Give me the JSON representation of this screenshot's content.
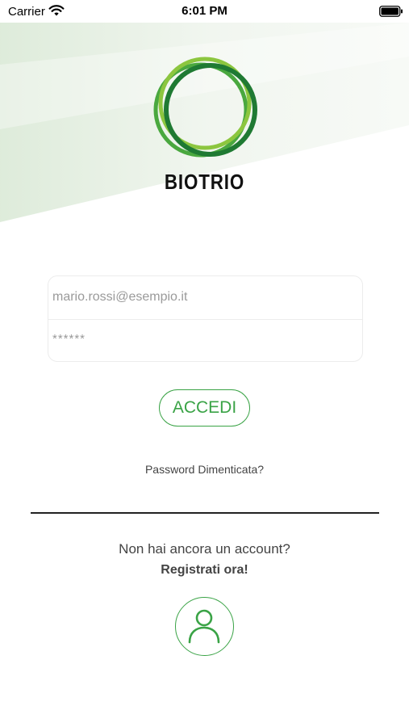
{
  "status_bar": {
    "carrier": "Carrier",
    "time": "6:01 PM"
  },
  "brand": {
    "name": "BIOTRIO"
  },
  "login_form": {
    "email_placeholder": "mario.rossi@esempio.it",
    "password_placeholder": "******"
  },
  "actions": {
    "login_label": "ACCEDI",
    "forgot_password": "Password Dimenticata?",
    "no_account": "Non hai ancora un account?",
    "register": "Registrati ora!"
  },
  "colors": {
    "accent_green": "#3aa346",
    "dark_green": "#1f7a33",
    "light_green": "#8cc63f",
    "text_gray": "#444444"
  },
  "icons": {
    "wifi": "wifi-icon",
    "battery": "battery-icon",
    "user": "user-icon"
  }
}
